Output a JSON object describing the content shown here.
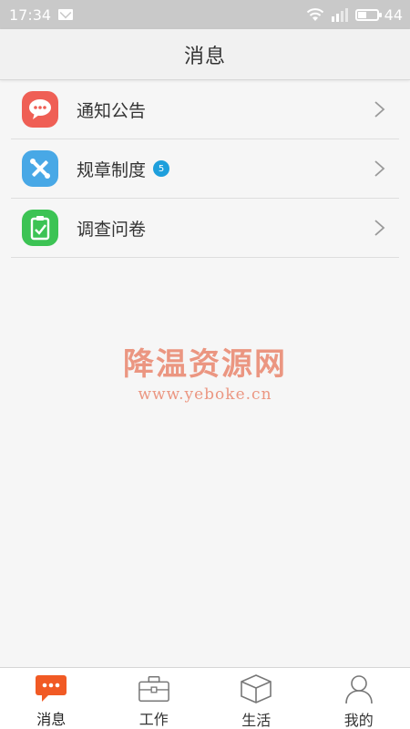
{
  "status_bar": {
    "time": "17:34",
    "battery": "44",
    "battery_level": 0.44,
    "icons": [
      "mail-icon",
      "wifi-icon",
      "signal-icon",
      "battery-icon"
    ]
  },
  "header": {
    "title": "消息"
  },
  "list": {
    "items": [
      {
        "label": "通知公告",
        "icon": "chat-bubble-icon",
        "color": "#ef5f55"
      },
      {
        "label": "规章制度",
        "icon": "tools-icon",
        "color": "#48a8e6",
        "badge": "5"
      },
      {
        "label": "调查问卷",
        "icon": "clipboard-check-icon",
        "color": "#3cc354"
      }
    ]
  },
  "watermark": {
    "title": "降温资源网",
    "url": "www.yeboke.cn"
  },
  "tab_bar": {
    "active_color": "#f15a24",
    "tabs": [
      {
        "label": "消息",
        "icon": "message-icon",
        "active": true
      },
      {
        "label": "工作",
        "icon": "briefcase-icon"
      },
      {
        "label": "生活",
        "icon": "box-icon"
      },
      {
        "label": "我的",
        "icon": "user-icon"
      }
    ]
  }
}
